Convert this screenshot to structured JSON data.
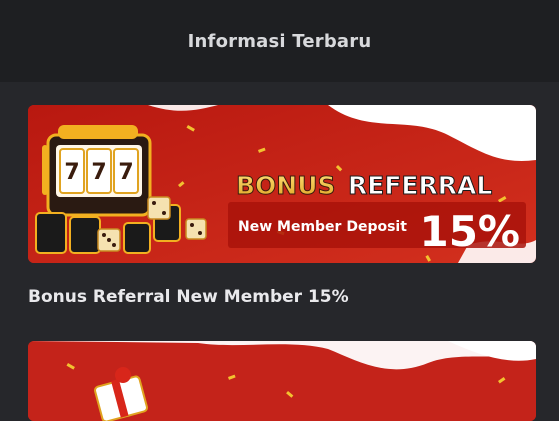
{
  "header": {
    "title": "Informasi Terbaru"
  },
  "news": [
    {
      "title": "Bonus Referral New Member 15%",
      "banner": {
        "word1": "BONUS",
        "word2": "REFERRAL",
        "subtitle": "New Member Deposit",
        "percent": "15%",
        "icon": "slot-machine-icon",
        "colors": {
          "bg": "#c4231a",
          "gold": "#f2c230",
          "white": "#ffffff"
        }
      }
    },
    {
      "title": "",
      "banner": {
        "icon": "gift-box-icon"
      }
    }
  ]
}
